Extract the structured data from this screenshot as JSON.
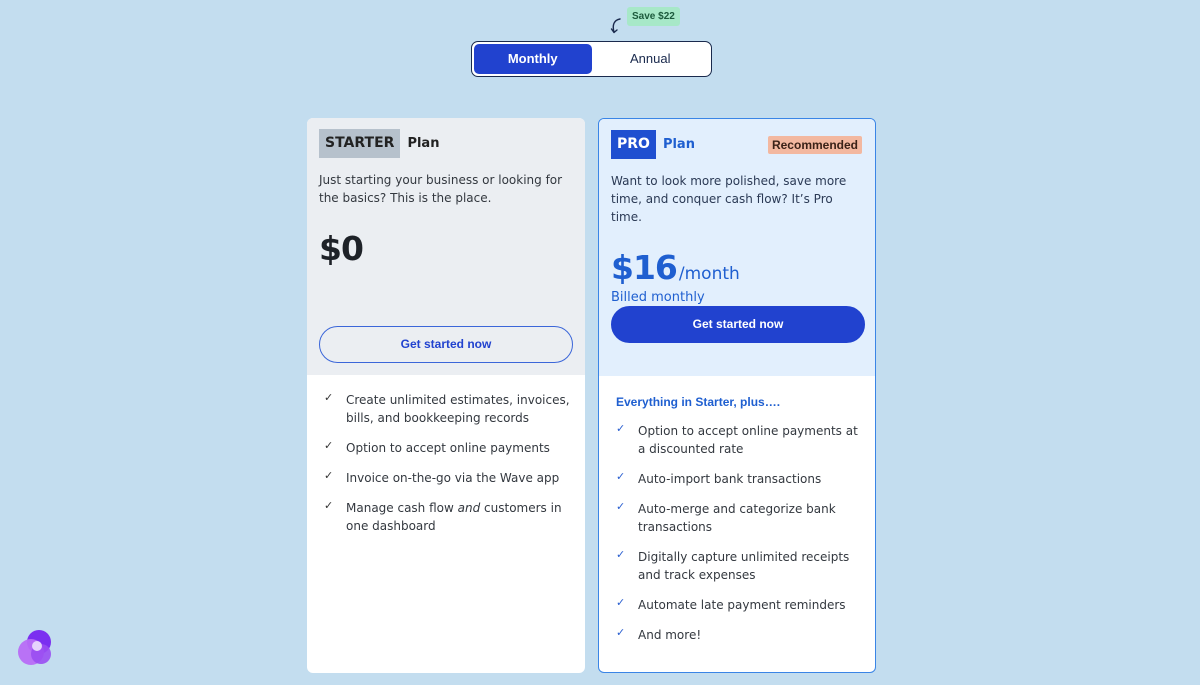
{
  "toggle": {
    "save_badge": "Save $22",
    "options": [
      "Monthly",
      "Annual"
    ],
    "selected": "Monthly"
  },
  "starter": {
    "tag": "STARTER",
    "plan_word": "Plan",
    "description": "Just starting your business or looking for the basics? This is the place.",
    "price": "$0",
    "cta": "Get started now",
    "features": [
      "Create unlimited estimates, invoices, bills, and bookkeeping records",
      "Option to accept online payments",
      "Invoice on-the-go via the Wave app",
      "Manage cash flow and customers in one dashboard"
    ]
  },
  "pro": {
    "tag": "PRO",
    "plan_word": "Plan",
    "badge": "Recommended",
    "description": "Want to look more polished, save more time, and conquer cash flow? It’s Pro time.",
    "price": "$16",
    "per": "/month",
    "billed": "Billed monthly",
    "cta": "Get started now",
    "features_heading": "Everything in Starter, plus….",
    "features": [
      "Option to accept online payments at a discounted rate",
      "Auto-import bank transactions",
      "Auto-merge and categorize bank transactions",
      "Digitally capture unlimited receipts and track expenses",
      "Automate late payment reminders",
      "And more!"
    ]
  },
  "icons": {
    "check": "check-icon",
    "arrow": "curved-arrow-icon",
    "logo": "app-logo-icon"
  },
  "colors": {
    "background": "#c3ddef",
    "accent": "#2142cf",
    "pro_blue": "#1f5fd0",
    "save_badge_bg": "#a7e8c8",
    "recommended_bg": "#f3b8a0"
  }
}
